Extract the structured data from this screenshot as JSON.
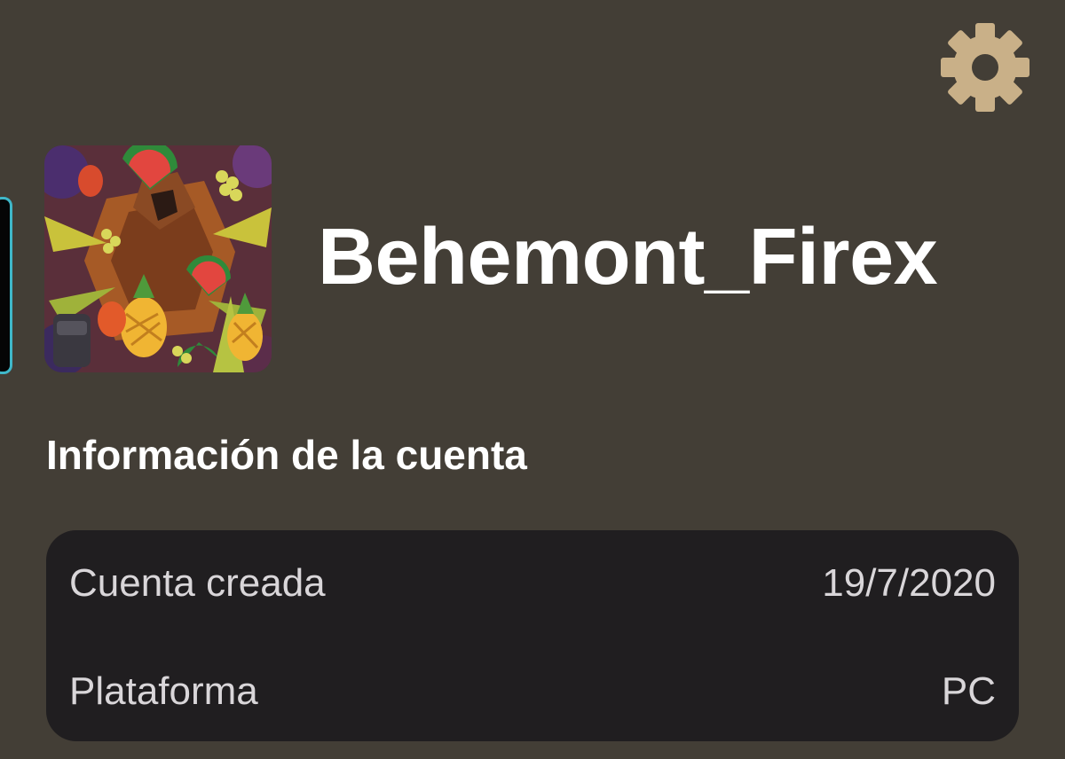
{
  "profile": {
    "username": "Behemont_Firex",
    "avatar_icon": "fruit-warrior-avatar-image",
    "settings_icon": "gear-icon"
  },
  "account_info": {
    "title": "Información de la cuenta",
    "rows": [
      {
        "label": "Cuenta creada",
        "value": "19/7/2020"
      },
      {
        "label": "Plataforma",
        "value": "PC"
      }
    ]
  },
  "colors": {
    "background": "#433e36",
    "card_background": "#201e20",
    "gear": "#c9b088",
    "side_tab_border": "#3fb7c9",
    "text_primary": "#ffffff",
    "text_secondary": "#d9d6d9"
  }
}
